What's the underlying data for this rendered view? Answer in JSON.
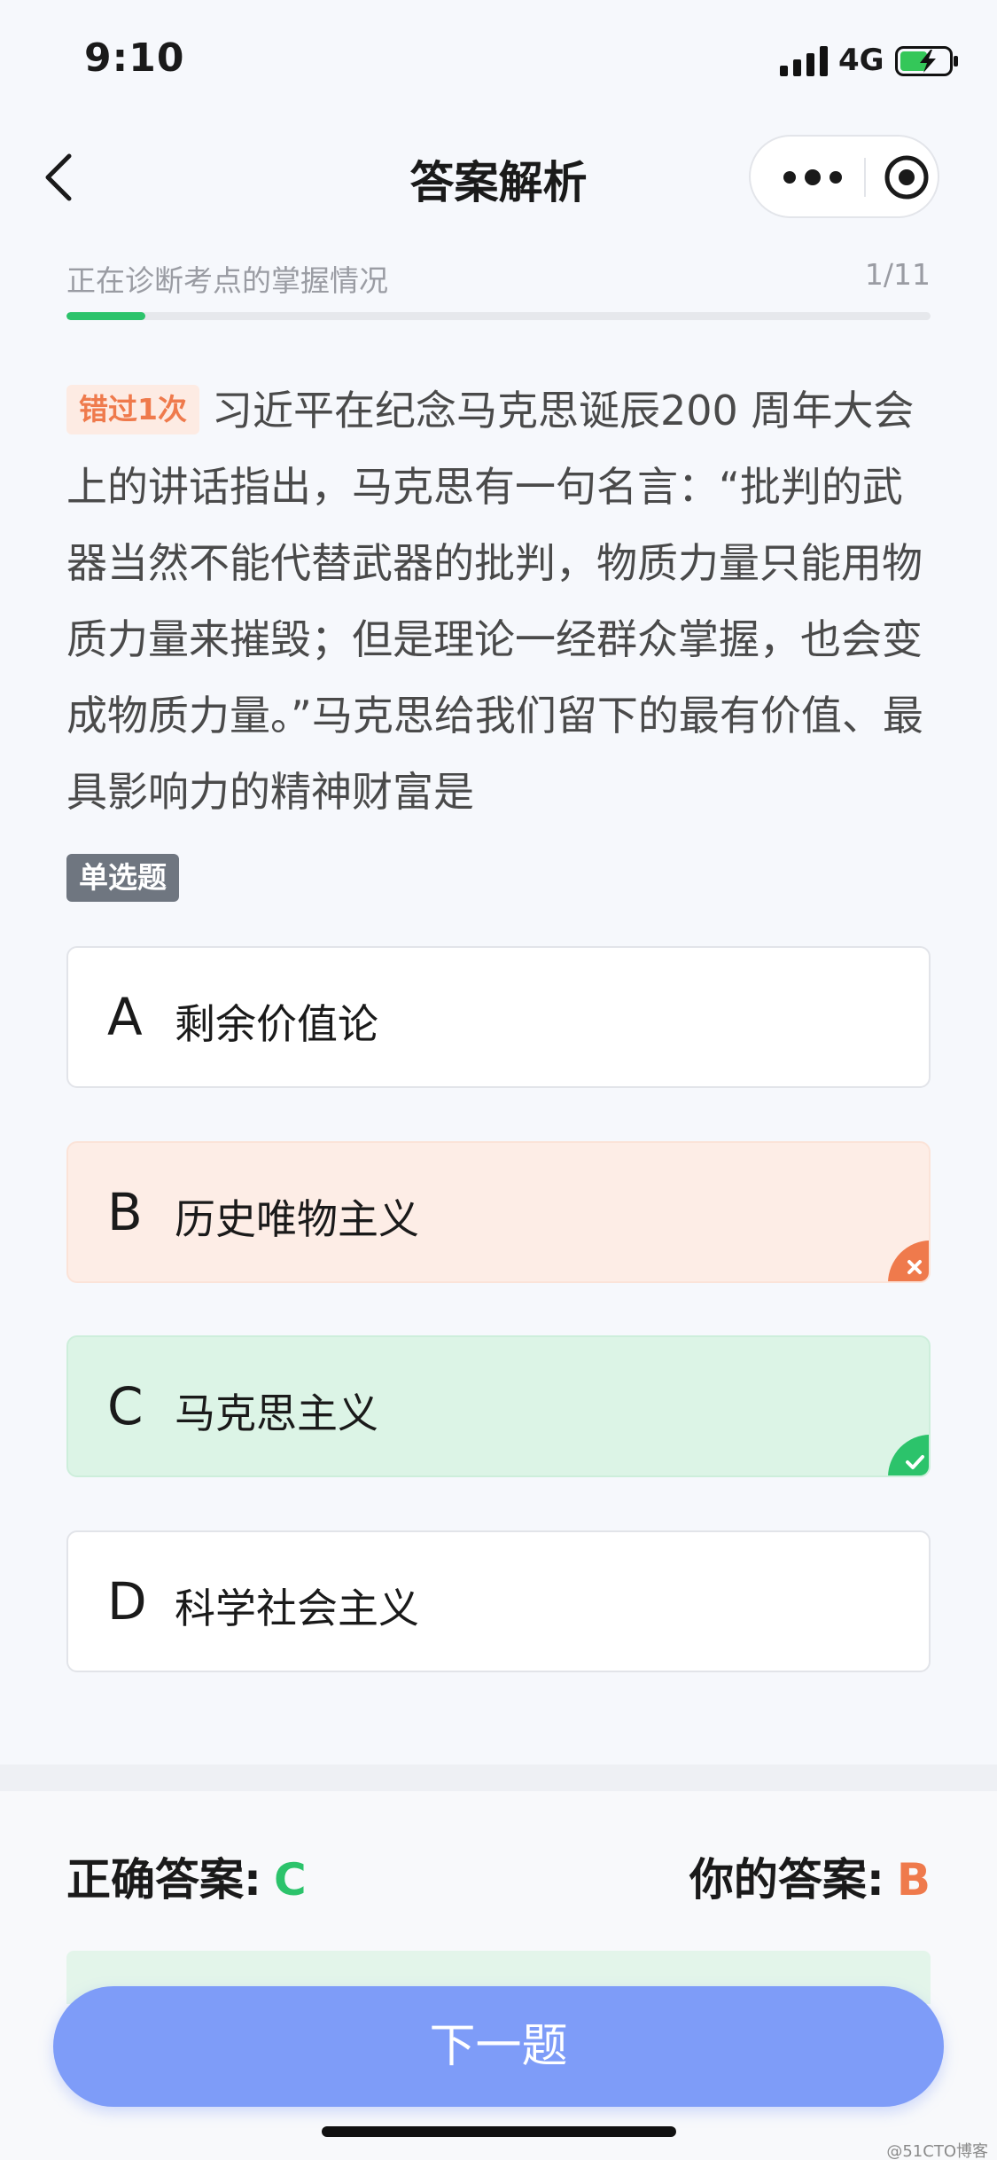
{
  "status_bar": {
    "time": "9:10",
    "network": "4G"
  },
  "nav": {
    "title": "答案解析"
  },
  "progress": {
    "label": "正在诊断考点的掌握情况",
    "count": "1/11",
    "fraction": 0.0909
  },
  "question": {
    "missed_badge": "错过1次",
    "text": "习近平在纪念马克思诞辰200 周年大会上的讲话指出，马克思有一句名言：“批判的武器当然不能代替武器的批判，物质力量只能用物质力量来摧毁；但是理论一经群众掌握，也会变成物质力量。”马克思给我们留下的最有价值、最具影响力的精神财富是",
    "type_tag": "单选题"
  },
  "options": [
    {
      "letter": "A",
      "text": "剩余价值论",
      "state": "normal"
    },
    {
      "letter": "B",
      "text": "历史唯物主义",
      "state": "wrong"
    },
    {
      "letter": "C",
      "text": "马克思主义",
      "state": "correct"
    },
    {
      "letter": "D",
      "text": "科学社会主义",
      "state": "normal"
    }
  ],
  "answers": {
    "correct_label": "正确答案:",
    "correct_value": "C",
    "yours_label": "你的答案:",
    "yours_value": "B"
  },
  "next_button": "下一题",
  "watermark": "@51CTO博客",
  "colors": {
    "accent_green": "#2cc36b",
    "accent_orange": "#ef7a4c",
    "button_blue": "#7e9cf8",
    "wrong_bg": "#fdede6",
    "correct_bg": "#dcf4e6"
  },
  "icons": [
    "signal-icon",
    "battery-charging-icon",
    "back-icon",
    "more-icon",
    "target-icon",
    "wrong-mark-icon",
    "correct-mark-icon"
  ]
}
